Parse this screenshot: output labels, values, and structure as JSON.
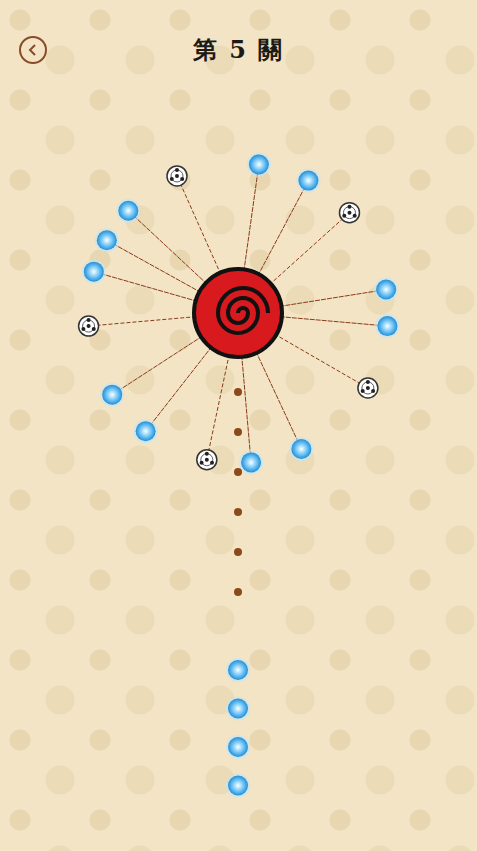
{
  "level_title": "第 5 關",
  "pins": [
    {
      "angle": 8,
      "kind": "orb"
    },
    {
      "angle": 28,
      "kind": "orb"
    },
    {
      "angle": 48,
      "kind": "sharingan"
    },
    {
      "angle": 81,
      "kind": "orb"
    },
    {
      "angle": 95,
      "kind": "orb"
    },
    {
      "angle": 120,
      "kind": "sharingan"
    },
    {
      "angle": 155,
      "kind": "orb"
    },
    {
      "angle": 175,
      "kind": "orb"
    },
    {
      "angle": 192,
      "kind": "sharingan"
    },
    {
      "angle": 218,
      "kind": "orb"
    },
    {
      "angle": 237,
      "kind": "orb"
    },
    {
      "angle": 265,
      "kind": "sharingan"
    },
    {
      "angle": 286,
      "kind": "orb"
    },
    {
      "angle": 299,
      "kind": "orb"
    },
    {
      "angle": 313,
      "kind": "orb"
    },
    {
      "angle": 336,
      "kind": "sharingan"
    }
  ],
  "aim_dots": 6,
  "queue": [
    {
      "kind": "orb"
    },
    {
      "kind": "orb"
    },
    {
      "kind": "orb"
    },
    {
      "kind": "orb"
    }
  ]
}
